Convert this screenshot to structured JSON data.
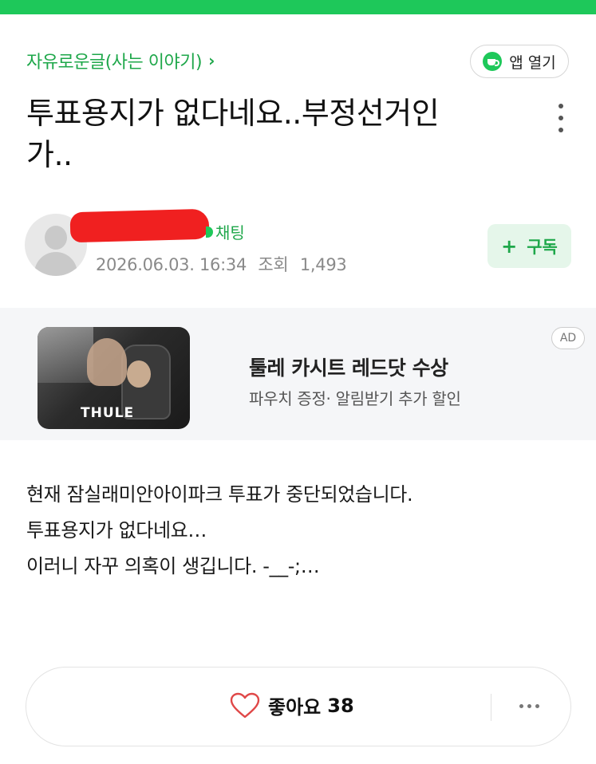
{
  "header": {
    "category": "자유로운글(사는 이야기)",
    "category_chevron": "›",
    "app_button_label": "앱 열기"
  },
  "post": {
    "title_line1": "투표용지가 없다네요..부정선거인",
    "title_line2": "가..",
    "author_chat_label": "채팅",
    "date": "2026.06.03. 16:34",
    "views_label": "조회",
    "views": "1,493",
    "subscribe_label": "구독",
    "subscribe_plus": "+"
  },
  "ad": {
    "brand": "THULE",
    "title": "툴레 카시트 레드닷 수상",
    "subtitle": "파우치 증정· 알림받기 추가 할인",
    "badge": "AD"
  },
  "body": {
    "lines": [
      "현재 잠실래미안아이파크 투표가 중단되었습니다.",
      "투표용지가 없다네요…",
      "이러니 자꾸 의혹이 생깁니다. -__-;…"
    ]
  },
  "footer": {
    "like_label": "좋아요",
    "like_count": "38"
  },
  "colors": {
    "accent": "#1ea74a",
    "top_bar": "#1ec85a",
    "redaction": "#f02020"
  },
  "icons": {
    "app": "coffee-cup-icon",
    "more": "more-vertical-icon",
    "like": "heart-outline-icon",
    "footer_more": "more-horizontal-icon"
  }
}
